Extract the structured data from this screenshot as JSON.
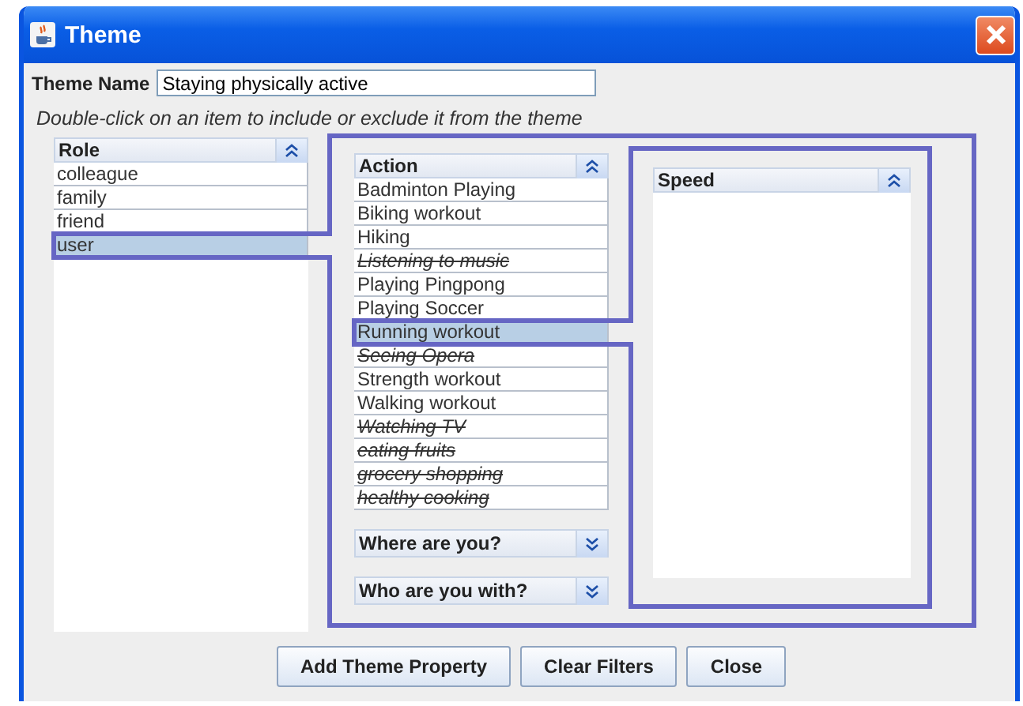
{
  "window": {
    "title": "Theme"
  },
  "theme_name": {
    "label": "Theme Name",
    "value": "Staying physically active"
  },
  "hint": "Double-click on an item to include or exclude it from the theme",
  "role_list": {
    "header": "Role",
    "items": [
      {
        "label": "colleague",
        "selected": false,
        "excluded": false
      },
      {
        "label": "family",
        "selected": false,
        "excluded": false
      },
      {
        "label": "friend",
        "selected": false,
        "excluded": false
      },
      {
        "label": "user",
        "selected": true,
        "excluded": false
      }
    ]
  },
  "action_list": {
    "header": "Action",
    "items": [
      {
        "label": "Badminton Playing",
        "selected": false,
        "excluded": false
      },
      {
        "label": "Biking workout",
        "selected": false,
        "excluded": false
      },
      {
        "label": "Hiking",
        "selected": false,
        "excluded": false
      },
      {
        "label": "Listening to music",
        "selected": false,
        "excluded": true
      },
      {
        "label": "Playing Pingpong",
        "selected": false,
        "excluded": false
      },
      {
        "label": "Playing Soccer",
        "selected": false,
        "excluded": false
      },
      {
        "label": "Running workout",
        "selected": true,
        "excluded": false
      },
      {
        "label": "Seeing Opera",
        "selected": false,
        "excluded": true
      },
      {
        "label": "Strength workout",
        "selected": false,
        "excluded": false
      },
      {
        "label": "Walking workout",
        "selected": false,
        "excluded": false
      },
      {
        "label": "Watching TV",
        "selected": false,
        "excluded": true
      },
      {
        "label": "eating fruits",
        "selected": false,
        "excluded": true
      },
      {
        "label": "grocery shopping",
        "selected": false,
        "excluded": true
      },
      {
        "label": "healthy cooking",
        "selected": false,
        "excluded": true
      }
    ]
  },
  "collapsed_panels": [
    {
      "header": "Where are you?"
    },
    {
      "header": "Who are you with?"
    }
  ],
  "speed_list": {
    "header": "Speed"
  },
  "buttons": [
    "Add Theme Property",
    "Clear Filters",
    "Close"
  ]
}
